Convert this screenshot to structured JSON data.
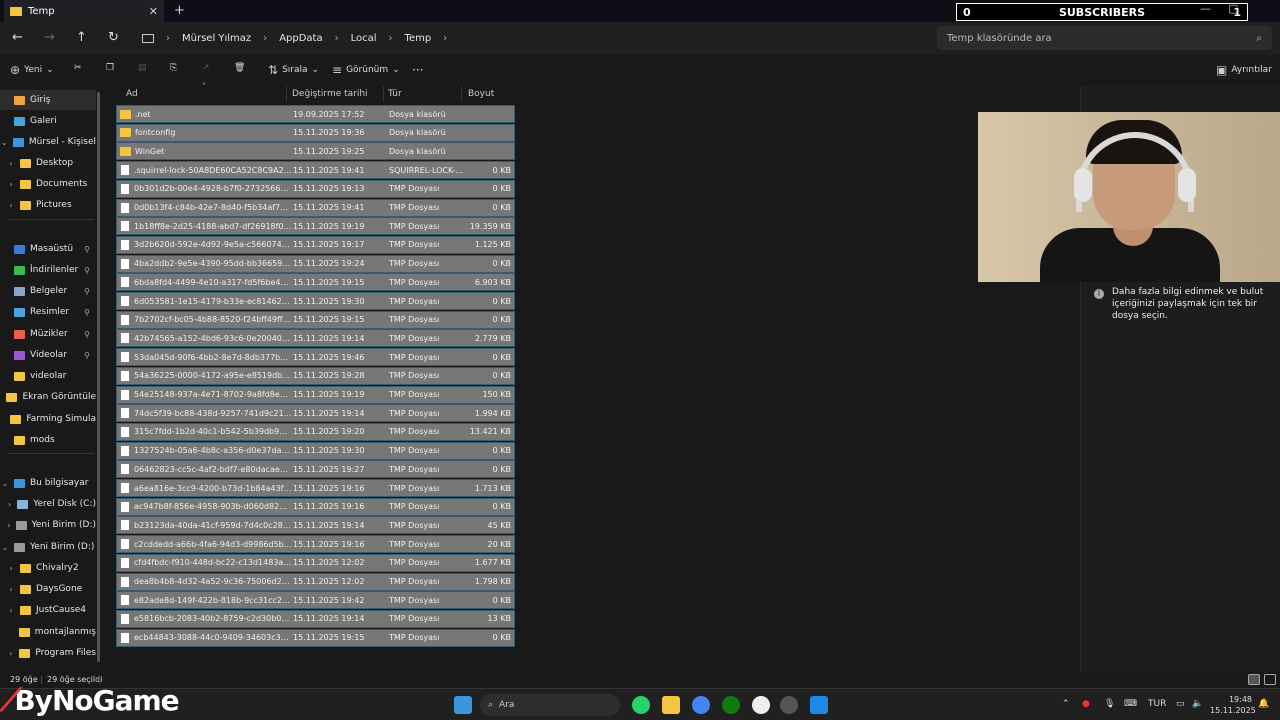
{
  "window": {
    "tab_title": "Temp",
    "close_glyph": "✕",
    "new_tab_glyph": "+"
  },
  "overlay": {
    "subscriber_count": "0",
    "subscribers_label": "SUBSCRIBERS",
    "subscriber_goal": "1"
  },
  "nav": {
    "back": "←",
    "forward": "→",
    "up": "↑",
    "refresh": "↻",
    "breadcrumb": [
      "Mürsel Yılmaz",
      "AppData",
      "Local",
      "Temp"
    ],
    "sep": "›",
    "search_placeholder": "Temp klasöründe ara"
  },
  "toolbar": {
    "new_label": "Yeni",
    "sort_label": "Sırala",
    "view_label": "Görünüm",
    "more": "···",
    "details_label": "Ayrıntılar"
  },
  "sidebar": {
    "items": [
      {
        "label": "Giriş",
        "icon": "home-icon",
        "color": "#f0a640"
      },
      {
        "label": "Galeri",
        "icon": "gallery-icon",
        "color": "#4aa3df"
      },
      {
        "label": "Mürsel - Kişisel",
        "icon": "cloud-icon",
        "color": "#3a96dd"
      },
      {
        "label": "Desktop",
        "icon": "folder-icon",
        "color": "#f4c542"
      },
      {
        "label": "Documents",
        "icon": "folder-icon",
        "color": "#f4c542"
      },
      {
        "label": "Pictures",
        "icon": "folder-icon",
        "color": "#f4c542"
      },
      {
        "label": "Masaüstü",
        "icon": "desktop-icon",
        "color": "#3a7bd5"
      },
      {
        "label": "İndirilenler",
        "icon": "download-icon",
        "color": "#3fb950"
      },
      {
        "label": "Belgeler",
        "icon": "documents-icon",
        "color": "#8aa4c8"
      },
      {
        "label": "Resimler",
        "icon": "pictures-icon",
        "color": "#4aa3df"
      },
      {
        "label": "Müzikler",
        "icon": "music-icon",
        "color": "#e8604c"
      },
      {
        "label": "Videolar",
        "icon": "video-icon",
        "color": "#9b59d0"
      },
      {
        "label": "videolar",
        "icon": "folder-icon",
        "color": "#f4c542"
      },
      {
        "label": "Ekran Görüntüle",
        "icon": "folder-icon",
        "color": "#f4c542"
      },
      {
        "label": "Farming Simula",
        "icon": "folder-icon",
        "color": "#f4c542"
      },
      {
        "label": "mods",
        "icon": "folder-icon",
        "color": "#f4c542"
      },
      {
        "label": "Bu bilgisayar",
        "icon": "computer-icon",
        "color": "#3a96dd"
      },
      {
        "label": "Yerel Disk (C:)",
        "icon": "drive-icon",
        "color": "#8ab4d8"
      },
      {
        "label": "Yeni Birim (D:)",
        "icon": "drive-icon",
        "color": "#999999"
      },
      {
        "label": "Yeni Birim (D:)",
        "icon": "drive-icon",
        "color": "#999999"
      },
      {
        "label": "Chivalry2",
        "icon": "folder-icon",
        "color": "#f4c542"
      },
      {
        "label": "DaysGone",
        "icon": "folder-icon",
        "color": "#f4c542"
      },
      {
        "label": "JustCause4",
        "icon": "folder-icon",
        "color": "#f4c542"
      },
      {
        "label": "montajlanmış",
        "icon": "folder-icon",
        "color": "#f4c542"
      },
      {
        "label": "Program Files",
        "icon": "folder-icon",
        "color": "#f4c542"
      }
    ],
    "pin_glyph": "📌",
    "chevron_right": "›",
    "chevron_down": "⌄"
  },
  "columns": {
    "name": "Ad",
    "date": "Değiştirme tarihi",
    "type": "Tür",
    "size": "Boyut"
  },
  "files": [
    {
      "name": ".net",
      "date": "19.09.2025 17:52",
      "type": "Dosya klasörü",
      "size": "",
      "kind": "folder"
    },
    {
      "name": "fontconfig",
      "date": "15.11.2025 19:36",
      "type": "Dosya klasörü",
      "size": "",
      "kind": "folder"
    },
    {
      "name": "WinGet",
      "date": "15.11.2025 19:25",
      "type": "Dosya klasörü",
      "size": "",
      "kind": "folder"
    },
    {
      "name": ".squirrel-lock-50A8DE60CA52C8C9A2A28...",
      "date": "15.11.2025 19:41",
      "type": "SQUIRREL-LOCK-...",
      "size": "0 KB",
      "kind": "file"
    },
    {
      "name": "0b301d2b-00e4-4928-b7f0-273256632bc3...",
      "date": "15.11.2025 19:13",
      "type": "TMP Dosyası",
      "size": "0 KB",
      "kind": "file"
    },
    {
      "name": "0d0b13f4-c84b-42e7-8d40-f5b34af7866f.t...",
      "date": "15.11.2025 19:41",
      "type": "TMP Dosyası",
      "size": "0 KB",
      "kind": "file"
    },
    {
      "name": "1b18ff8e-2d25-4188-abd7-df26918f0454.t...",
      "date": "15.11.2025 19:19",
      "type": "TMP Dosyası",
      "size": "19.359 KB",
      "kind": "file"
    },
    {
      "name": "3d2b620d-592e-4d92-9e5a-c566074be623...",
      "date": "15.11.2025 19:17",
      "type": "TMP Dosyası",
      "size": "1.125 KB",
      "kind": "file"
    },
    {
      "name": "4ba2ddb2-9e5e-4390-95dd-bb36659980b...",
      "date": "15.11.2025 19:24",
      "type": "TMP Dosyası",
      "size": "0 KB",
      "kind": "file"
    },
    {
      "name": "6bda8fd4-4499-4e10-a317-fd5f6be4a9d0...",
      "date": "15.11.2025 19:15",
      "type": "TMP Dosyası",
      "size": "6.903 KB",
      "kind": "file"
    },
    {
      "name": "6d053581-1e15-4179-b33e-ec8146277c3a...",
      "date": "15.11.2025 19:30",
      "type": "TMP Dosyası",
      "size": "0 KB",
      "kind": "file"
    },
    {
      "name": "7b2702cf-bc05-4b88-8520-f24bff49ff3b.t...",
      "date": "15.11.2025 19:15",
      "type": "TMP Dosyası",
      "size": "0 KB",
      "kind": "file"
    },
    {
      "name": "42b74565-a152-4bd6-93c6-0e20040afa77...",
      "date": "15.11.2025 19:14",
      "type": "TMP Dosyası",
      "size": "2.779 KB",
      "kind": "file"
    },
    {
      "name": "53da045d-90f6-4bb2-8e7d-8db377bc17d...",
      "date": "15.11.2025 19:46",
      "type": "TMP Dosyası",
      "size": "0 KB",
      "kind": "file"
    },
    {
      "name": "54a36225-0000-4172-a95e-e8519dbe41ff.t...",
      "date": "15.11.2025 19:28",
      "type": "TMP Dosyası",
      "size": "0 KB",
      "kind": "file"
    },
    {
      "name": "54e25148-937a-4e71-8702-9a8fd8e7736c...",
      "date": "15.11.2025 19:19",
      "type": "TMP Dosyası",
      "size": "150 KB",
      "kind": "file"
    },
    {
      "name": "74dc5f39-bc88-438d-9257-741d9c21b961...",
      "date": "15.11.2025 19:14",
      "type": "TMP Dosyası",
      "size": "1.994 KB",
      "kind": "file"
    },
    {
      "name": "315c7fdd-1b2d-40c1-b542-5b39db95f11b...",
      "date": "15.11.2025 19:20",
      "type": "TMP Dosyası",
      "size": "13.421 KB",
      "kind": "file"
    },
    {
      "name": "1327524b-05a6-4b8c-a356-d0e37da556ef...",
      "date": "15.11.2025 19:30",
      "type": "TMP Dosyası",
      "size": "0 KB",
      "kind": "file"
    },
    {
      "name": "06462823-cc5c-4af2-bdf7-e80dacaeb66c...",
      "date": "15.11.2025 19:27",
      "type": "TMP Dosyası",
      "size": "0 KB",
      "kind": "file"
    },
    {
      "name": "a6ea816e-3cc9-4200-b73d-1b84a43fc8ee...",
      "date": "15.11.2025 19:16",
      "type": "TMP Dosyası",
      "size": "1.713 KB",
      "kind": "file"
    },
    {
      "name": "ac947b8f-856e-4958-903b-d060d82d549e...",
      "date": "15.11.2025 19:16",
      "type": "TMP Dosyası",
      "size": "0 KB",
      "kind": "file"
    },
    {
      "name": "b23123da-40da-41cf-959d-7d4c0c286a54...",
      "date": "15.11.2025 19:14",
      "type": "TMP Dosyası",
      "size": "45 KB",
      "kind": "file"
    },
    {
      "name": "c2cddedd-a66b-4fa6-94d3-d9986d5b3cf9...",
      "date": "15.11.2025 19:16",
      "type": "TMP Dosyası",
      "size": "20 KB",
      "kind": "file"
    },
    {
      "name": "cfd4fbdc-f910-448d-bc22-c13d1483a930...",
      "date": "15.11.2025 12:02",
      "type": "TMP Dosyası",
      "size": "1.677 KB",
      "kind": "file"
    },
    {
      "name": "dea8b4b8-4d32-4a52-9c36-75006d2a3e8...",
      "date": "15.11.2025 12:02",
      "type": "TMP Dosyası",
      "size": "1.798 KB",
      "kind": "file"
    },
    {
      "name": "e82ade8d-149f-422b-818b-9cc31cc21197...",
      "date": "15.11.2025 19:42",
      "type": "TMP Dosyası",
      "size": "0 KB",
      "kind": "file"
    },
    {
      "name": "e5816bcb-2083-40b2-8759-c2d30b02c690...",
      "date": "15.11.2025 19:14",
      "type": "TMP Dosyası",
      "size": "13 KB",
      "kind": "file"
    },
    {
      "name": "ecb44843-3088-44c0-9409-34603c304a86...",
      "date": "15.11.2025 19:15",
      "type": "TMP Dosyası",
      "size": "0 KB",
      "kind": "file"
    }
  ],
  "details_pane": {
    "info_glyph": "i",
    "message": "Daha fazla bilgi edinmek ve bulut içeriğinizi paylaşmak için tek bir dosya seçin."
  },
  "statusbar": {
    "count": "29 öğe",
    "selected": "29 öğe seçildi"
  },
  "taskbar": {
    "brand": "ByNoGame",
    "search_label": "Ara",
    "language": "TUR",
    "time": "19:48",
    "date": "15.11.2025"
  }
}
